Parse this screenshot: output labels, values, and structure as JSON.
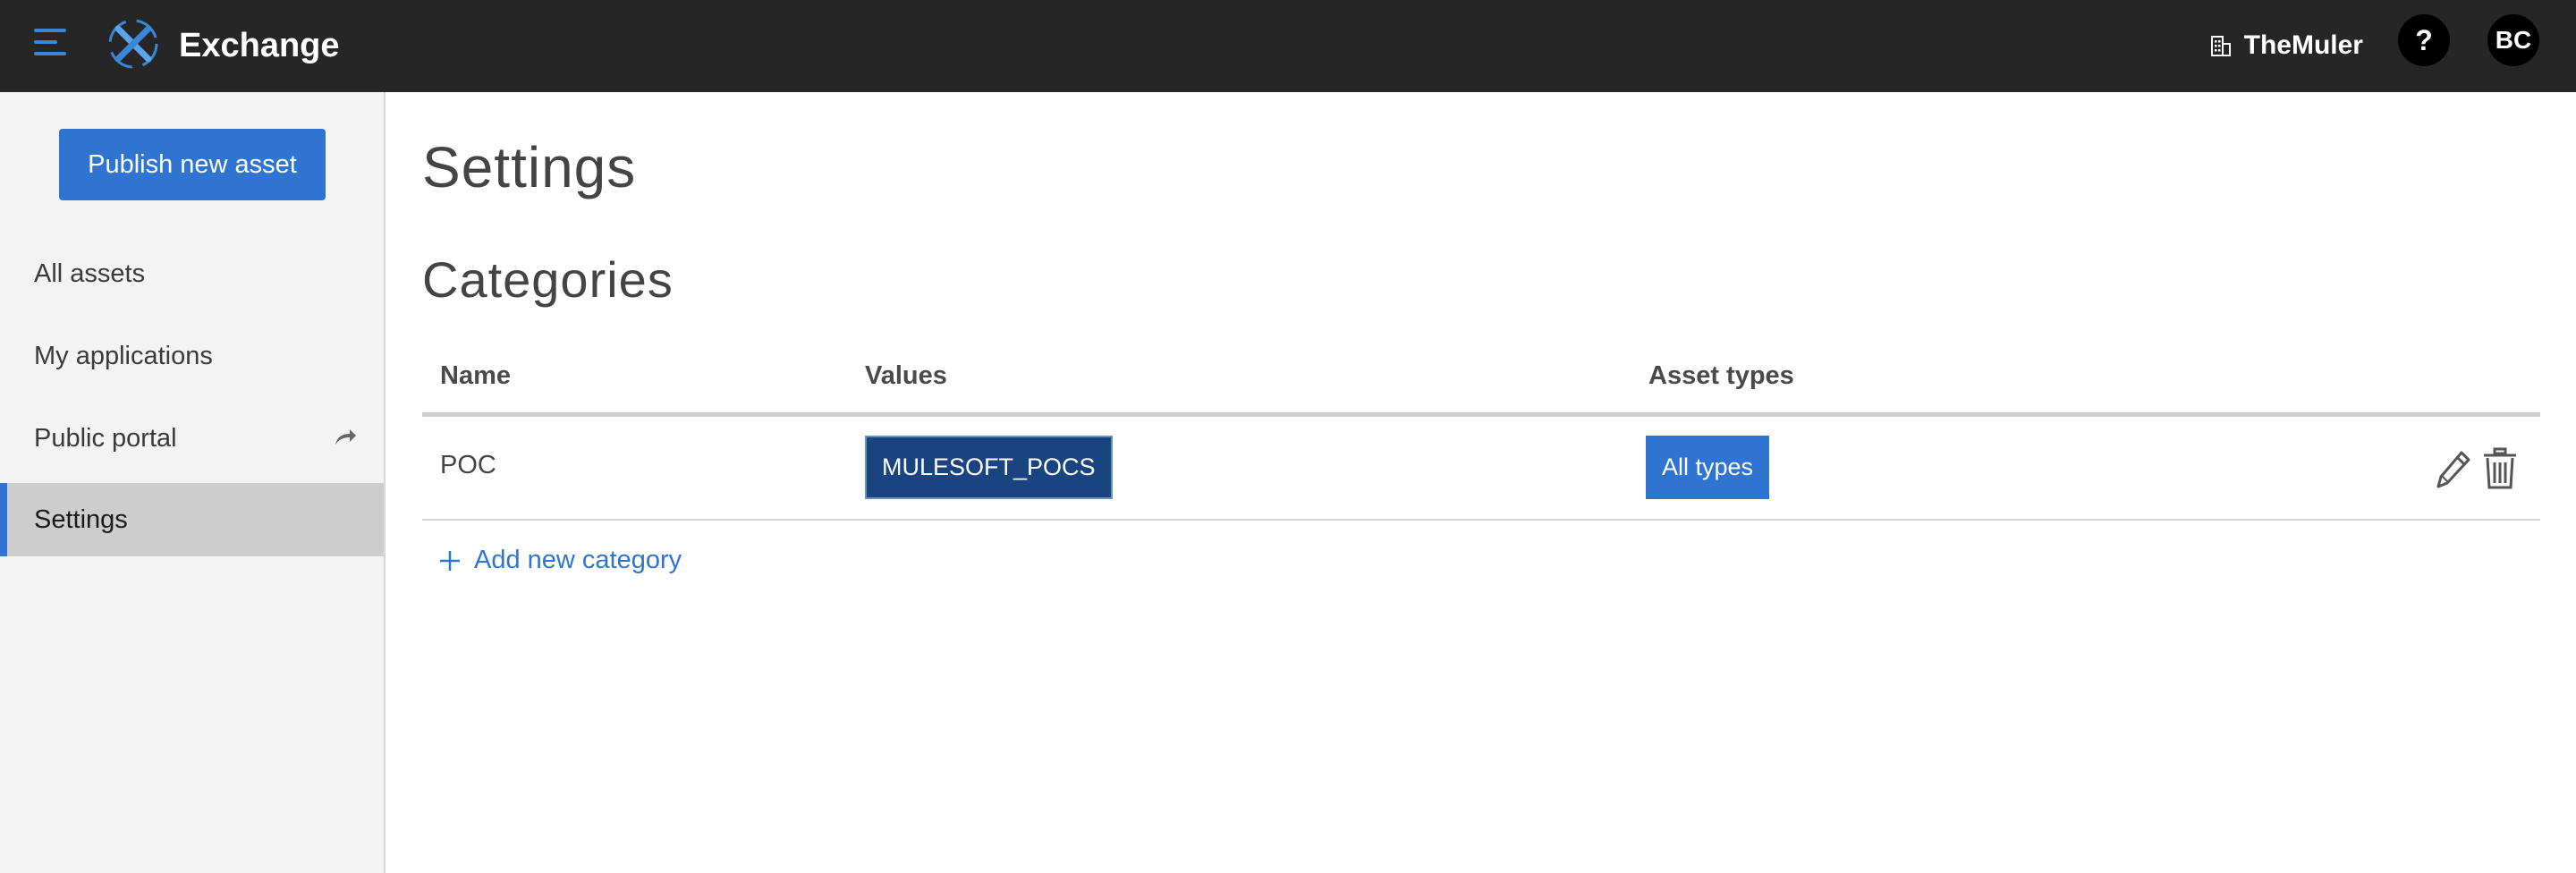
{
  "header": {
    "app_title": "Exchange",
    "org_name": "TheMuler",
    "help_label": "?",
    "avatar_initials": "BC"
  },
  "sidebar": {
    "publish_label": "Publish new asset",
    "items": [
      {
        "label": "All assets"
      },
      {
        "label": "My applications"
      },
      {
        "label": "Public portal"
      },
      {
        "label": "Settings",
        "active": true
      }
    ]
  },
  "main": {
    "page_title": "Settings",
    "section_title": "Categories",
    "table": {
      "columns": [
        "Name",
        "Values",
        "Asset types"
      ],
      "rows": [
        {
          "name": "POC",
          "value": "MULESOFT_POCS",
          "asset_types": "All types"
        }
      ]
    },
    "add_category_label": "Add new category"
  },
  "colors": {
    "topbar": "#262626",
    "accent": "#2f74d0",
    "value_pill": "#1a4480",
    "sidebar_bg": "#f3f3f3",
    "active_item_bg": "#cdcdcd"
  },
  "icons": [
    "menu-icon",
    "exchange-logo-icon",
    "building-icon",
    "share-arrow-icon",
    "pencil-icon",
    "trash-icon",
    "plus-icon"
  ]
}
